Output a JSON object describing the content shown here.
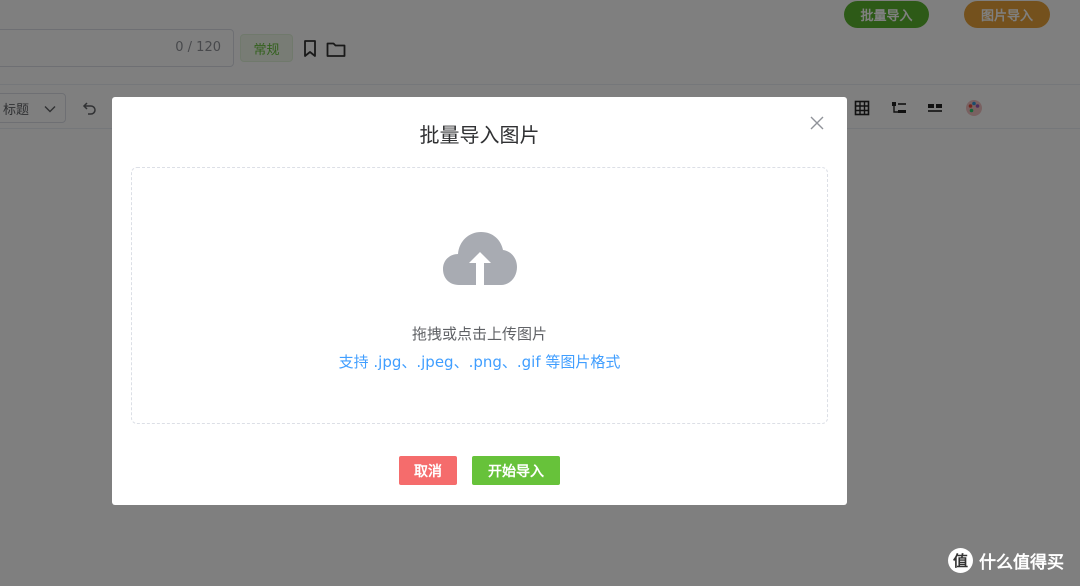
{
  "header": {
    "batch_import_label": "批量导入",
    "image_import_label": "图片导入",
    "title_counter": "0 / 120",
    "normal_tag": "常规"
  },
  "toolbar": {
    "heading_select_value": "标题"
  },
  "dialog": {
    "title": "批量导入图片",
    "drop_text": "拖拽或点击上传图片",
    "format_tip": "支持 .jpg、.jpeg、.png、.gif 等图片格式",
    "cancel_label": "取消",
    "start_label": "开始导入"
  },
  "watermark": {
    "logo_char": "值",
    "text": "什么值得买"
  },
  "colors": {
    "batch_button": "#5ab52f",
    "image_button": "#e8a33a",
    "cancel_button": "#f56c6c",
    "start_button": "#67c23a",
    "format_tip": "#409eff",
    "upload_icon": "#a8abb2"
  },
  "icons": {
    "bookmark": "bookmark-icon",
    "folder": "folder-icon",
    "undo": "undo-icon",
    "table": "table-icon",
    "list": "list-icon",
    "columns": "columns-icon",
    "palette": "palette-icon",
    "close": "close-icon",
    "upload": "cloud-upload-icon"
  }
}
